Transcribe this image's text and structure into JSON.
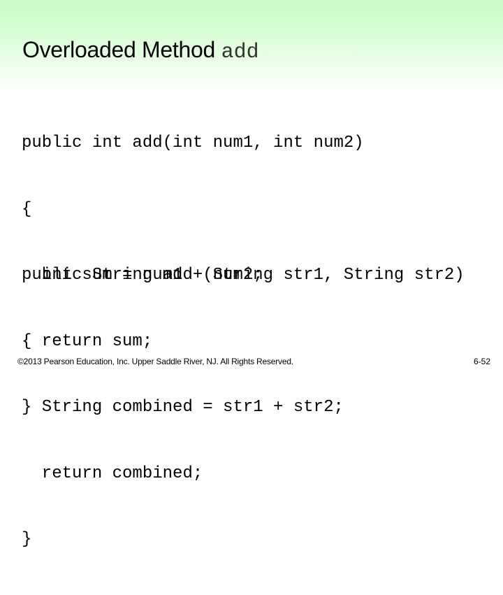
{
  "slide": {
    "title": {
      "text": "Overloaded Method ",
      "code": "add"
    },
    "code_blocks": [
      {
        "lines": [
          "public int add(int num1, int num2)",
          "{",
          "  int sum = num1 + num2;",
          "  return sum;",
          "}"
        ]
      },
      {
        "lines": [
          "public String add (String str1, String str2)",
          "{",
          "  String combined = str1 + str2;",
          "  return combined;",
          "}"
        ]
      }
    ],
    "footer": {
      "copyright": "©2013 Pearson Education, Inc. Upper Saddle River, NJ. All Rights Reserved.",
      "page_number": "6-52"
    },
    "colors": {
      "header_gradient_top": "#c9fcc6",
      "background": "#ffffff",
      "text": "#000000"
    }
  }
}
